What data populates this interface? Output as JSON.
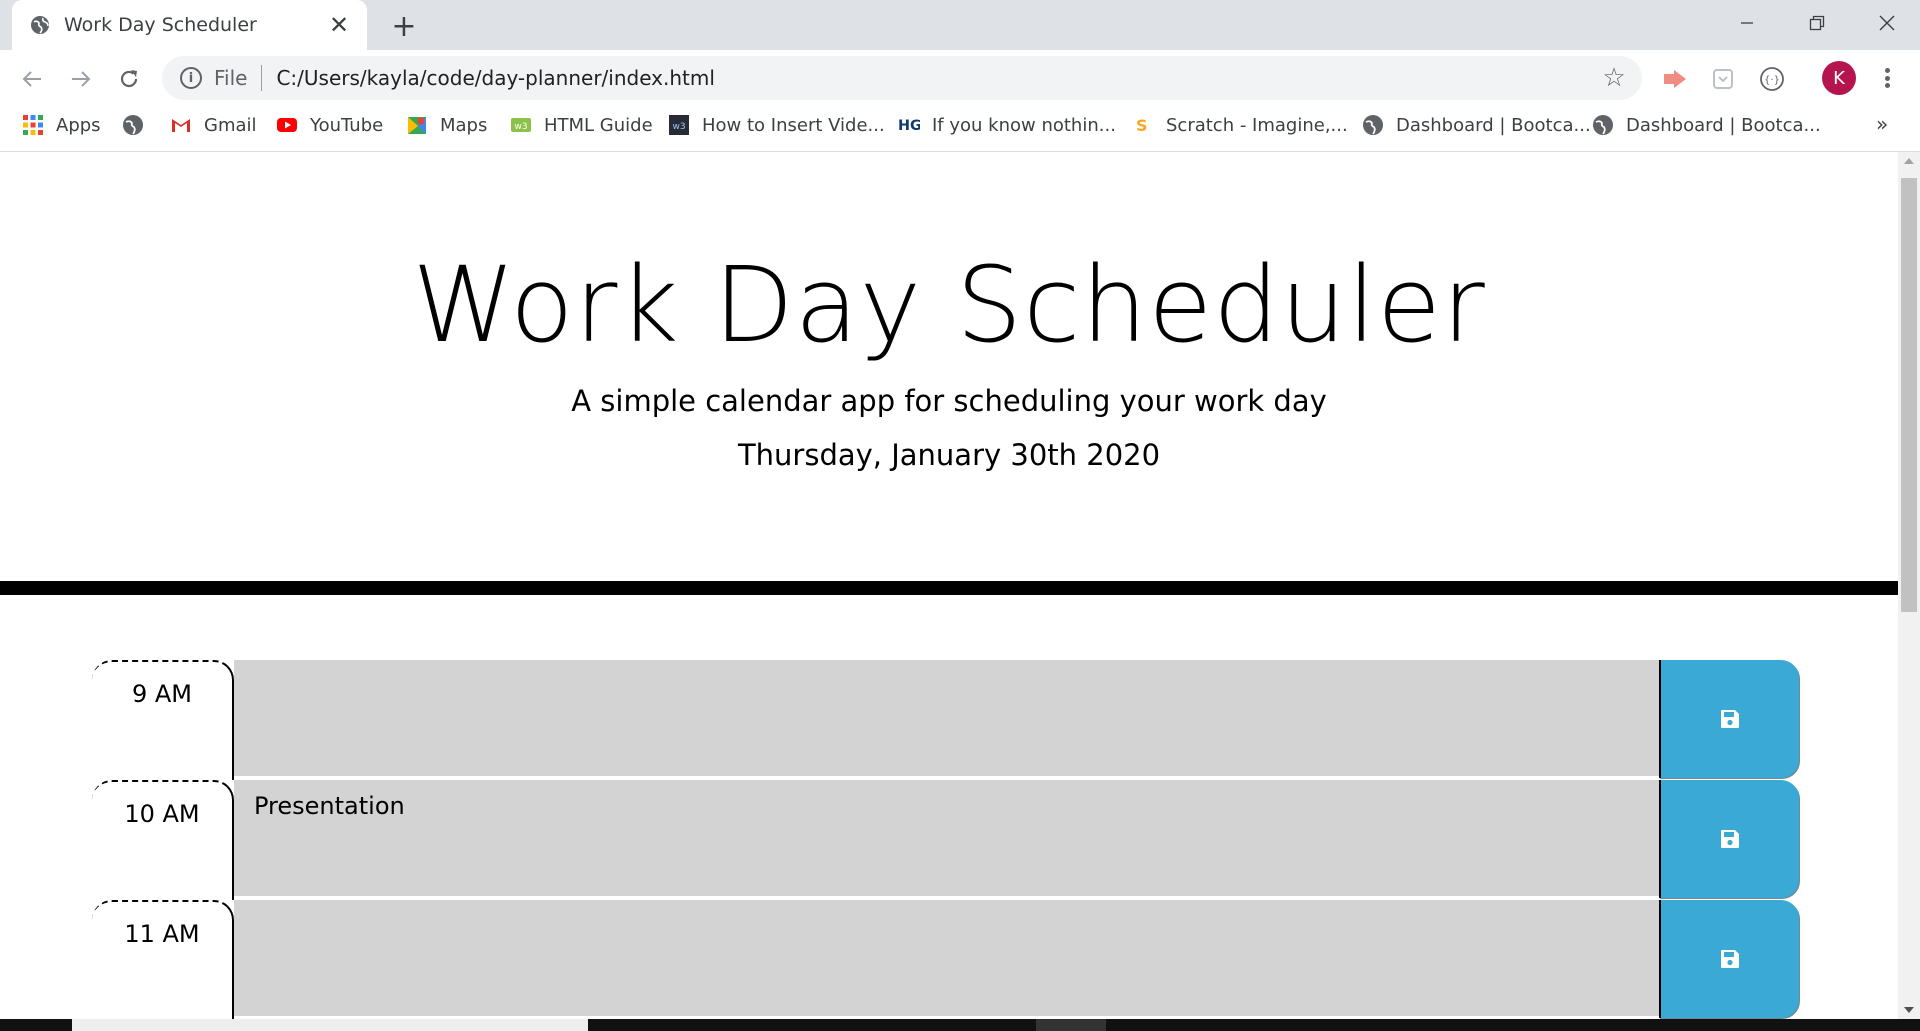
{
  "browser": {
    "tab": {
      "title": "Work Day Scheduler",
      "close_label": "✕"
    },
    "new_tab_label": "+",
    "omnibox": {
      "scheme": "File",
      "url": "C:/Users/kayla/code/day-planner/index.html"
    },
    "avatar_initial": "K",
    "bookmarks": [
      {
        "label": "Apps",
        "icon": "apps-grid-icon"
      },
      {
        "label": "",
        "icon": "globe-icon"
      },
      {
        "label": "Gmail",
        "icon": "gmail-icon"
      },
      {
        "label": "YouTube",
        "icon": "youtube-icon"
      },
      {
        "label": "Maps",
        "icon": "maps-icon"
      },
      {
        "label": "HTML Guide",
        "icon": "w3-icon"
      },
      {
        "label": "How to Insert Vide...",
        "icon": "w3schools-icon"
      },
      {
        "label": "If you know nothin...",
        "icon": "hg-icon"
      },
      {
        "label": "Scratch - Imagine,...",
        "icon": "scratch-icon"
      },
      {
        "label": "Dashboard | Bootca...",
        "icon": "globe-icon"
      },
      {
        "label": "Dashboard | Bootca...",
        "icon": "globe-icon"
      }
    ],
    "bookmarks_more": "»"
  },
  "page": {
    "title": "Work Day Scheduler",
    "lead": "A simple calendar app for scheduling your work day",
    "current_day": "Thursday, January 30th 2020",
    "time_blocks": [
      {
        "hour": "9 AM",
        "text": ""
      },
      {
        "hour": "10 AM",
        "text": "Presentation"
      },
      {
        "hour": "11 AM",
        "text": ""
      }
    ]
  },
  "colors": {
    "save_button": "#3ba9d6",
    "description_bg": "#d3d3d3",
    "divider": "#000000"
  }
}
